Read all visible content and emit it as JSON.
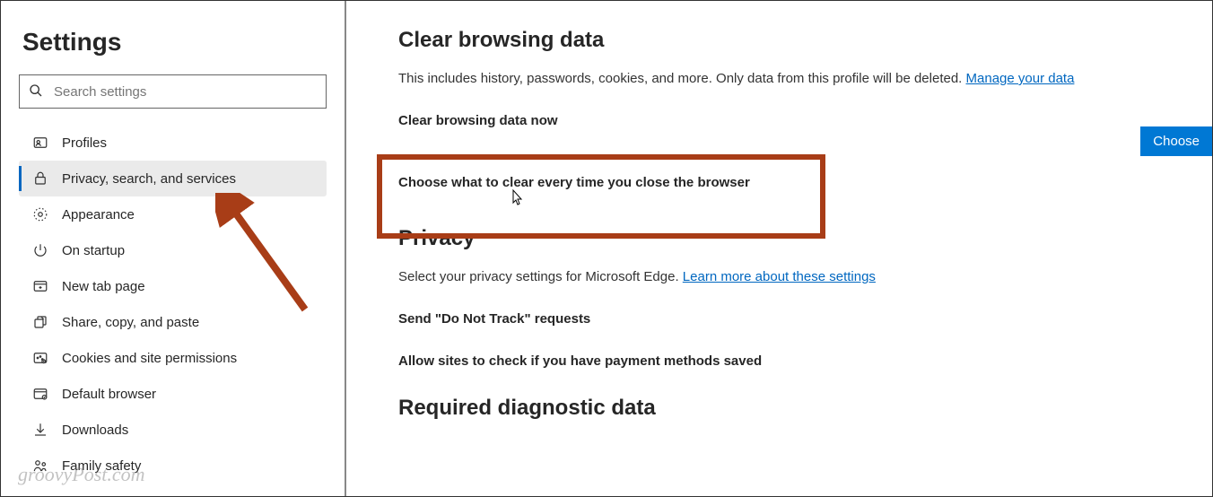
{
  "sidebar": {
    "title": "Settings",
    "search_placeholder": "Search settings",
    "items": [
      {
        "label": "Profiles"
      },
      {
        "label": "Privacy, search, and services"
      },
      {
        "label": "Appearance"
      },
      {
        "label": "On startup"
      },
      {
        "label": "New tab page"
      },
      {
        "label": "Share, copy, and paste"
      },
      {
        "label": "Cookies and site permissions"
      },
      {
        "label": "Default browser"
      },
      {
        "label": "Downloads"
      },
      {
        "label": "Family safety"
      }
    ]
  },
  "main": {
    "clear_heading": "Clear browsing data",
    "clear_desc": "This includes history, passwords, cookies, and more. Only data from this profile will be deleted. ",
    "manage_link": "Manage your data",
    "clear_now": "Clear browsing data now",
    "choose_every": "Choose what to clear every time you close the browser",
    "choose_btn": "Choose",
    "privacy_heading": "Privacy",
    "privacy_desc": "Select your privacy settings for Microsoft Edge. ",
    "privacy_link": "Learn more about these settings",
    "dnt": "Send \"Do Not Track\" requests",
    "payment": "Allow sites to check if you have payment methods saved",
    "diag_heading": "Required diagnostic data"
  },
  "watermark": "groovyPost.com"
}
